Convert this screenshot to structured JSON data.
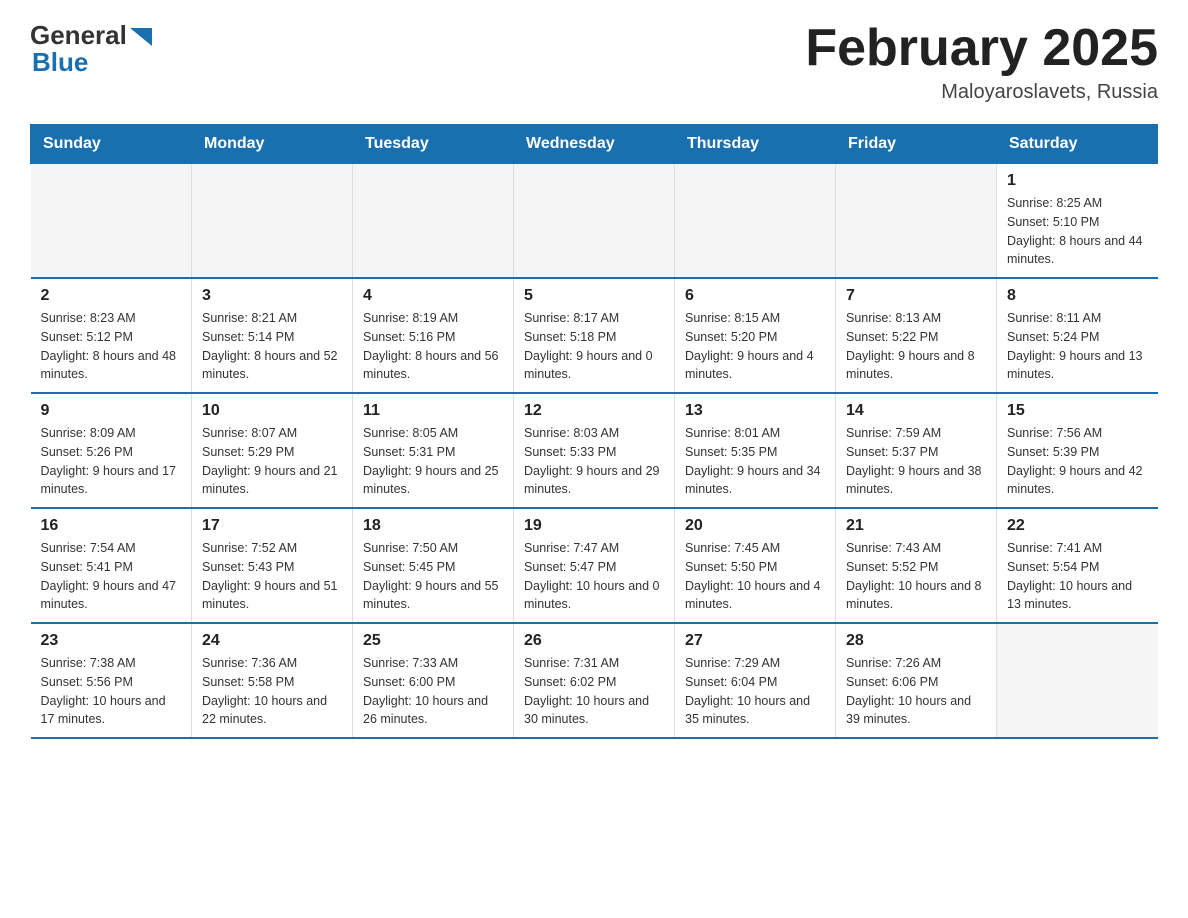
{
  "logo": {
    "general": "General",
    "blue": "Blue"
  },
  "title": "February 2025",
  "location": "Maloyaroslavets, Russia",
  "weekdays": [
    "Sunday",
    "Monday",
    "Tuesday",
    "Wednesday",
    "Thursday",
    "Friday",
    "Saturday"
  ],
  "weeks": [
    [
      {
        "day": "",
        "info": ""
      },
      {
        "day": "",
        "info": ""
      },
      {
        "day": "",
        "info": ""
      },
      {
        "day": "",
        "info": ""
      },
      {
        "day": "",
        "info": ""
      },
      {
        "day": "",
        "info": ""
      },
      {
        "day": "1",
        "info": "Sunrise: 8:25 AM\nSunset: 5:10 PM\nDaylight: 8 hours and 44 minutes."
      }
    ],
    [
      {
        "day": "2",
        "info": "Sunrise: 8:23 AM\nSunset: 5:12 PM\nDaylight: 8 hours and 48 minutes."
      },
      {
        "day": "3",
        "info": "Sunrise: 8:21 AM\nSunset: 5:14 PM\nDaylight: 8 hours and 52 minutes."
      },
      {
        "day": "4",
        "info": "Sunrise: 8:19 AM\nSunset: 5:16 PM\nDaylight: 8 hours and 56 minutes."
      },
      {
        "day": "5",
        "info": "Sunrise: 8:17 AM\nSunset: 5:18 PM\nDaylight: 9 hours and 0 minutes."
      },
      {
        "day": "6",
        "info": "Sunrise: 8:15 AM\nSunset: 5:20 PM\nDaylight: 9 hours and 4 minutes."
      },
      {
        "day": "7",
        "info": "Sunrise: 8:13 AM\nSunset: 5:22 PM\nDaylight: 9 hours and 8 minutes."
      },
      {
        "day": "8",
        "info": "Sunrise: 8:11 AM\nSunset: 5:24 PM\nDaylight: 9 hours and 13 minutes."
      }
    ],
    [
      {
        "day": "9",
        "info": "Sunrise: 8:09 AM\nSunset: 5:26 PM\nDaylight: 9 hours and 17 minutes."
      },
      {
        "day": "10",
        "info": "Sunrise: 8:07 AM\nSunset: 5:29 PM\nDaylight: 9 hours and 21 minutes."
      },
      {
        "day": "11",
        "info": "Sunrise: 8:05 AM\nSunset: 5:31 PM\nDaylight: 9 hours and 25 minutes."
      },
      {
        "day": "12",
        "info": "Sunrise: 8:03 AM\nSunset: 5:33 PM\nDaylight: 9 hours and 29 minutes."
      },
      {
        "day": "13",
        "info": "Sunrise: 8:01 AM\nSunset: 5:35 PM\nDaylight: 9 hours and 34 minutes."
      },
      {
        "day": "14",
        "info": "Sunrise: 7:59 AM\nSunset: 5:37 PM\nDaylight: 9 hours and 38 minutes."
      },
      {
        "day": "15",
        "info": "Sunrise: 7:56 AM\nSunset: 5:39 PM\nDaylight: 9 hours and 42 minutes."
      }
    ],
    [
      {
        "day": "16",
        "info": "Sunrise: 7:54 AM\nSunset: 5:41 PM\nDaylight: 9 hours and 47 minutes."
      },
      {
        "day": "17",
        "info": "Sunrise: 7:52 AM\nSunset: 5:43 PM\nDaylight: 9 hours and 51 minutes."
      },
      {
        "day": "18",
        "info": "Sunrise: 7:50 AM\nSunset: 5:45 PM\nDaylight: 9 hours and 55 minutes."
      },
      {
        "day": "19",
        "info": "Sunrise: 7:47 AM\nSunset: 5:47 PM\nDaylight: 10 hours and 0 minutes."
      },
      {
        "day": "20",
        "info": "Sunrise: 7:45 AM\nSunset: 5:50 PM\nDaylight: 10 hours and 4 minutes."
      },
      {
        "day": "21",
        "info": "Sunrise: 7:43 AM\nSunset: 5:52 PM\nDaylight: 10 hours and 8 minutes."
      },
      {
        "day": "22",
        "info": "Sunrise: 7:41 AM\nSunset: 5:54 PM\nDaylight: 10 hours and 13 minutes."
      }
    ],
    [
      {
        "day": "23",
        "info": "Sunrise: 7:38 AM\nSunset: 5:56 PM\nDaylight: 10 hours and 17 minutes."
      },
      {
        "day": "24",
        "info": "Sunrise: 7:36 AM\nSunset: 5:58 PM\nDaylight: 10 hours and 22 minutes."
      },
      {
        "day": "25",
        "info": "Sunrise: 7:33 AM\nSunset: 6:00 PM\nDaylight: 10 hours and 26 minutes."
      },
      {
        "day": "26",
        "info": "Sunrise: 7:31 AM\nSunset: 6:02 PM\nDaylight: 10 hours and 30 minutes."
      },
      {
        "day": "27",
        "info": "Sunrise: 7:29 AM\nSunset: 6:04 PM\nDaylight: 10 hours and 35 minutes."
      },
      {
        "day": "28",
        "info": "Sunrise: 7:26 AM\nSunset: 6:06 PM\nDaylight: 10 hours and 39 minutes."
      },
      {
        "day": "",
        "info": ""
      }
    ]
  ]
}
